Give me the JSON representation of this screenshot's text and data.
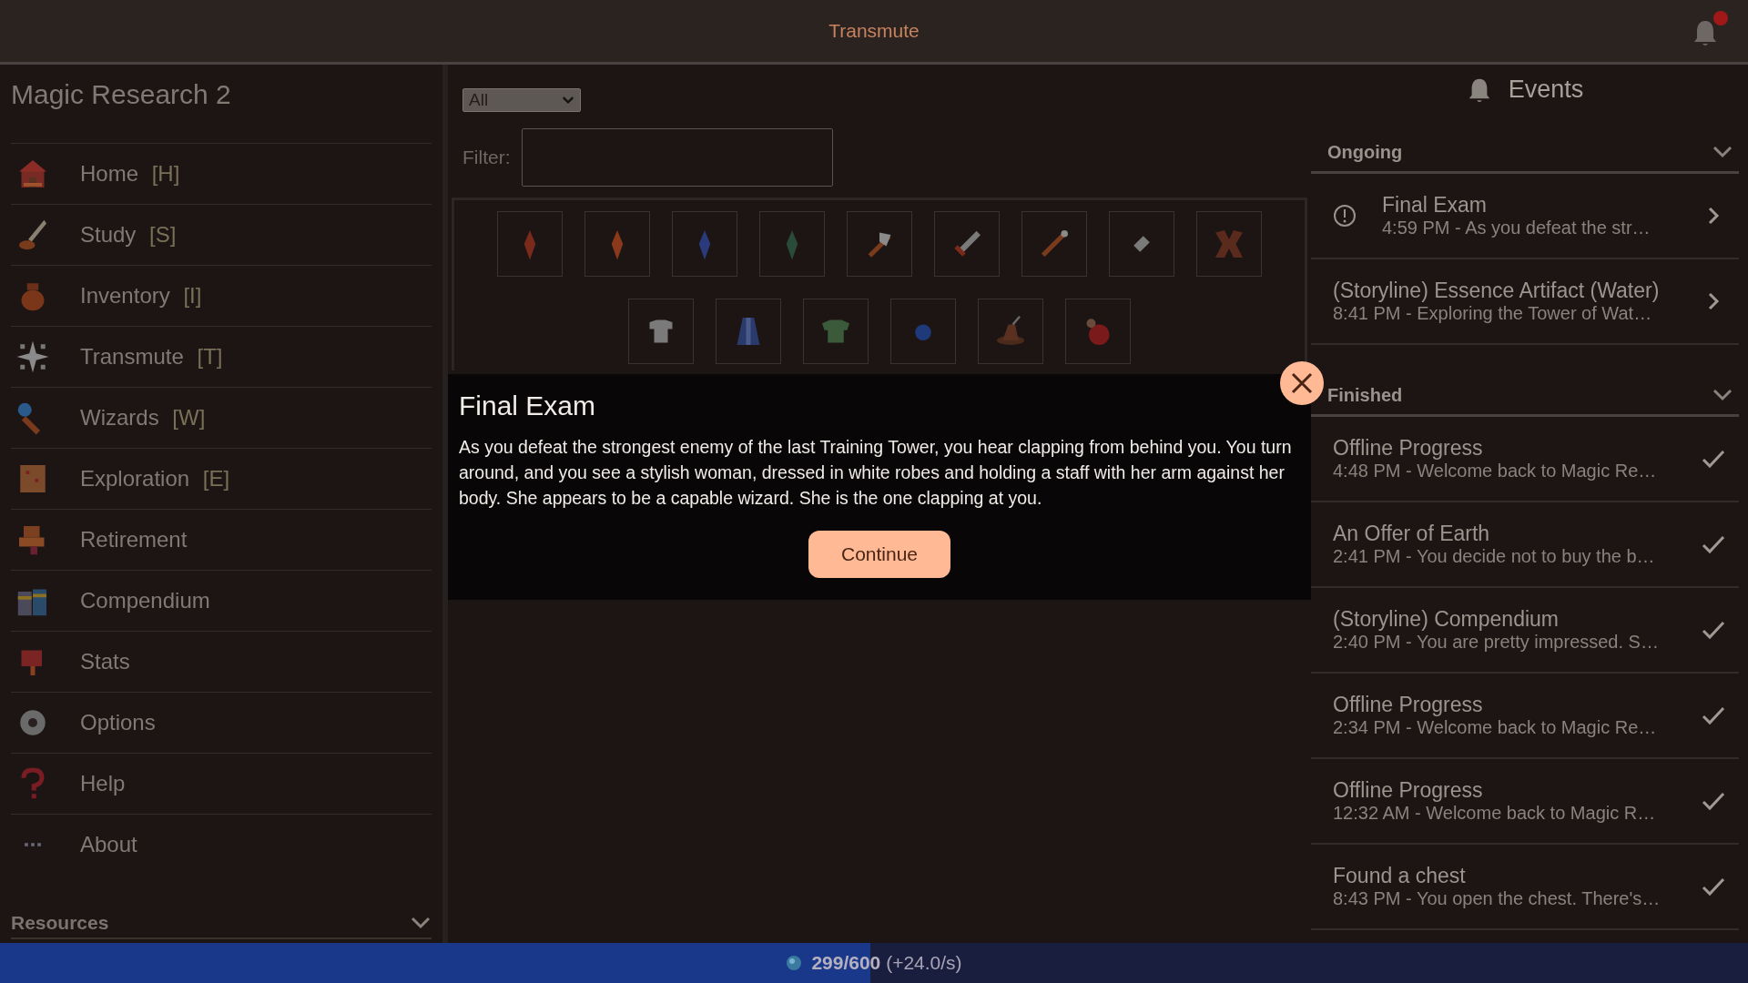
{
  "top_bar": {
    "title": "Transmute",
    "unread": true
  },
  "sidebar": {
    "title": "Magic Research 2",
    "items": [
      {
        "label": "Home",
        "shortcut": "[H]"
      },
      {
        "label": "Study",
        "shortcut": "[S]"
      },
      {
        "label": "Inventory",
        "shortcut": "[I]"
      },
      {
        "label": "Transmute",
        "shortcut": "[T]"
      },
      {
        "label": "Wizards",
        "shortcut": "[W]"
      },
      {
        "label": "Exploration",
        "shortcut": "[E]"
      },
      {
        "label": "Retirement"
      },
      {
        "label": "Compendium"
      },
      {
        "label": "Stats"
      },
      {
        "label": "Options"
      },
      {
        "label": "Help"
      },
      {
        "label": "About"
      }
    ],
    "resources": {
      "label": "Resources"
    }
  },
  "transmute": {
    "category": "All",
    "filter": {
      "label": "Filter:"
    }
  },
  "dialog": {
    "title": "Final Exam",
    "body": "As you defeat the strongest enemy of the last Training Tower, you hear clapping from behind you. You turn around, and you see a stylish woman, dressed in white robes and holding a staff with her arm against her body. She appears to be a capable wizard. She is the one clapping at you.",
    "button": "Continue"
  },
  "events": {
    "title": "Events",
    "sections": [
      {
        "title": "Ongoing",
        "items": [
          {
            "kind": "ongoing",
            "alert": true,
            "title": "Final Exam",
            "summary": "4:59 PM - As you defeat the str…"
          },
          {
            "kind": "ongoing",
            "alert": false,
            "title": "(Storyline) Essence Artifact (Water)",
            "summary": "8:41 PM - Exploring the Tower of Wat…"
          }
        ]
      },
      {
        "title": "Finished",
        "items": [
          {
            "kind": "finished",
            "title": "Offline Progress",
            "summary": "4:48 PM - Welcome back to Magic Re…"
          },
          {
            "kind": "finished",
            "title": "An Offer of Earth",
            "summary": "2:41 PM - You decide not to buy the b…"
          },
          {
            "kind": "finished",
            "title": "(Storyline) Compendium",
            "summary": "2:40 PM - You are pretty impressed. S…"
          },
          {
            "kind": "finished",
            "title": "Offline Progress",
            "summary": "2:34 PM - Welcome back to Magic Re…"
          },
          {
            "kind": "finished",
            "title": "Offline Progress",
            "summary": "12:32 AM - Welcome back to Magic R…"
          },
          {
            "kind": "finished",
            "title": "Found a chest",
            "summary": "8:43 PM - You open the chest. There's…"
          }
        ]
      }
    ]
  },
  "mana_bar": {
    "level": 0.498,
    "amount": "299/600",
    "rate": "(+24.0/s)"
  }
}
